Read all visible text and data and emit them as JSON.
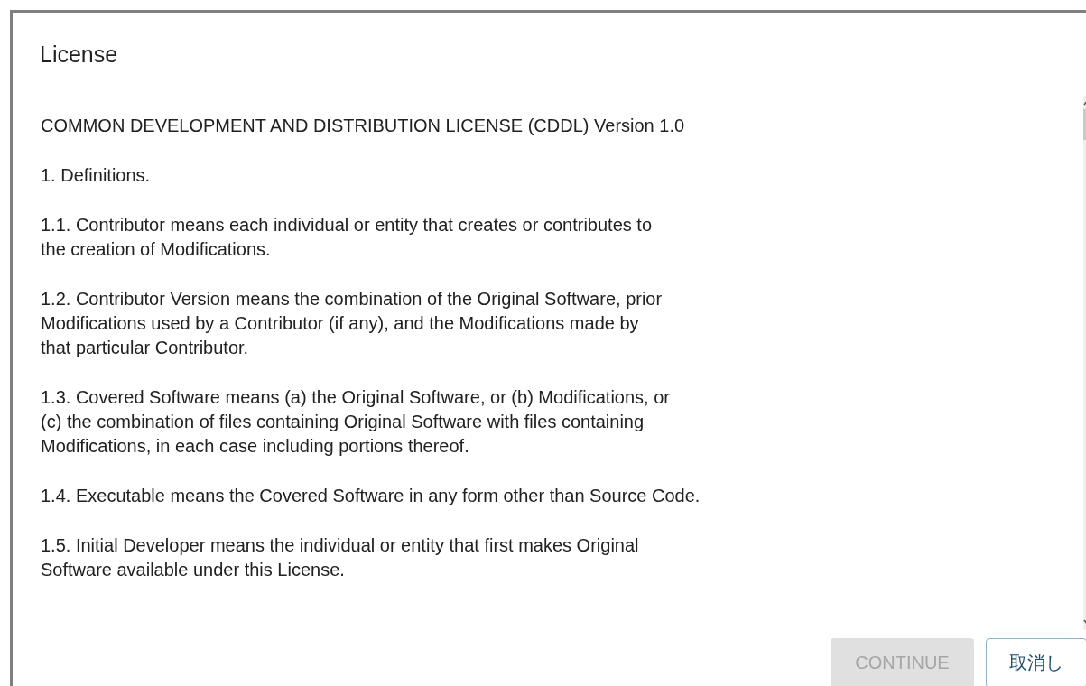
{
  "dialog": {
    "title": "License",
    "paragraphs": [
      "COMMON DEVELOPMENT AND DISTRIBUTION LICENSE (CDDL) Version 1.0",
      "1. Definitions.",
      "1.1. Contributor means each individual or entity that creates or contributes to\nthe creation of Modifications.",
      "1.2. Contributor Version means the combination of the Original Software, prior\nModifications used by a Contributor (if any), and the Modifications made by\nthat particular Contributor.",
      "1.3. Covered Software means (a) the Original Software, or (b) Modifications, or\n(c) the combination of files containing Original Software with files containing\nModifications, in each case including portions thereof.",
      "1.4. Executable means the Covered Software in any form other than Source Code.",
      "1.5. Initial Developer means the individual or entity that first makes Original\nSoftware available under this License."
    ],
    "buttons": [
      {
        "label": "CONTINUE",
        "kind": "primary",
        "disabled": true
      },
      {
        "label": "取消し",
        "kind": "secondary",
        "disabled": false
      }
    ]
  }
}
